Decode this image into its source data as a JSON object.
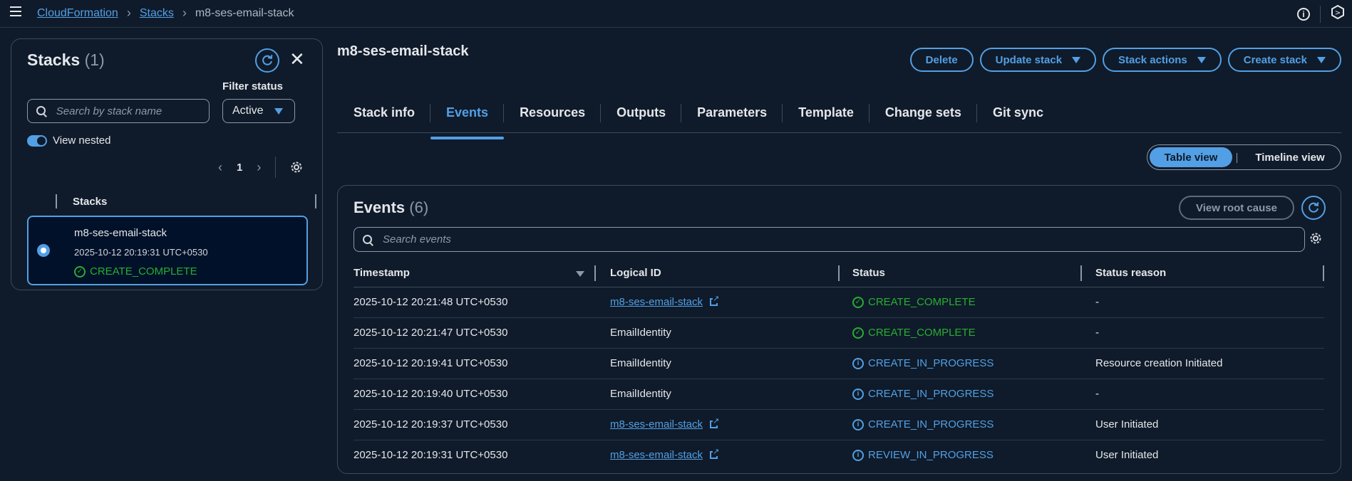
{
  "breadcrumb": {
    "items": [
      "CloudFormation",
      "Stacks"
    ],
    "current": "m8-ses-email-stack"
  },
  "left_panel": {
    "title": "Stacks",
    "count": "(1)",
    "filter_status_label": "Filter status",
    "search_placeholder": "Search by stack name",
    "status_value": "Active",
    "view_nested_label": "View nested",
    "page_number": "1",
    "column_header": "Stacks",
    "stacks": [
      {
        "name": "m8-ses-email-stack",
        "created": "2025-10-12 20:19:31 UTC+0530",
        "status": "CREATE_COMPLETE"
      }
    ]
  },
  "main": {
    "title": "m8-ses-email-stack",
    "actions": {
      "delete": "Delete",
      "update": "Update stack",
      "stack_actions": "Stack actions",
      "create": "Create stack"
    },
    "tabs": [
      "Stack info",
      "Events",
      "Resources",
      "Outputs",
      "Parameters",
      "Template",
      "Change sets",
      "Git sync"
    ],
    "active_tab": "Events",
    "view_toggle": {
      "table": "Table view",
      "timeline": "Timeline view"
    }
  },
  "events": {
    "title": "Events",
    "count": "(6)",
    "view_root_cause": "View root cause",
    "search_placeholder": "Search events",
    "columns": [
      "Timestamp",
      "Logical ID",
      "Status",
      "Status reason"
    ],
    "rows": [
      {
        "timestamp": "2025-10-12 20:21:48 UTC+0530",
        "logical_id": "m8-ses-email-stack",
        "logical_is_link": true,
        "status": "CREATE_COMPLETE",
        "status_kind": "ok",
        "reason": "-"
      },
      {
        "timestamp": "2025-10-12 20:21:47 UTC+0530",
        "logical_id": "EmailIdentity",
        "logical_is_link": false,
        "status": "CREATE_COMPLETE",
        "status_kind": "ok",
        "reason": "-"
      },
      {
        "timestamp": "2025-10-12 20:19:41 UTC+0530",
        "logical_id": "EmailIdentity",
        "logical_is_link": false,
        "status": "CREATE_IN_PROGRESS",
        "status_kind": "info",
        "reason": "Resource creation Initiated"
      },
      {
        "timestamp": "2025-10-12 20:19:40 UTC+0530",
        "logical_id": "EmailIdentity",
        "logical_is_link": false,
        "status": "CREATE_IN_PROGRESS",
        "status_kind": "info",
        "reason": "-"
      },
      {
        "timestamp": "2025-10-12 20:19:37 UTC+0530",
        "logical_id": "m8-ses-email-stack",
        "logical_is_link": true,
        "status": "CREATE_IN_PROGRESS",
        "status_kind": "info",
        "reason": "User Initiated"
      },
      {
        "timestamp": "2025-10-12 20:19:31 UTC+0530",
        "logical_id": "m8-ses-email-stack",
        "logical_is_link": true,
        "status": "REVIEW_IN_PROGRESS",
        "status_kind": "info",
        "reason": "User Initiated"
      }
    ]
  },
  "colors": {
    "background": "#0f1b2a",
    "accent": "#539fe5",
    "success": "#29ad32",
    "border": "#3c4a5a"
  },
  "icons": [
    "menu-icon",
    "chevron-right-icon",
    "info-icon",
    "cloudshell-icon",
    "refresh-icon",
    "close-icon",
    "search-icon",
    "chevron-left-icon",
    "gear-icon",
    "radio-selected-icon",
    "success-icon",
    "external-link-icon",
    "caret-down-icon"
  ]
}
